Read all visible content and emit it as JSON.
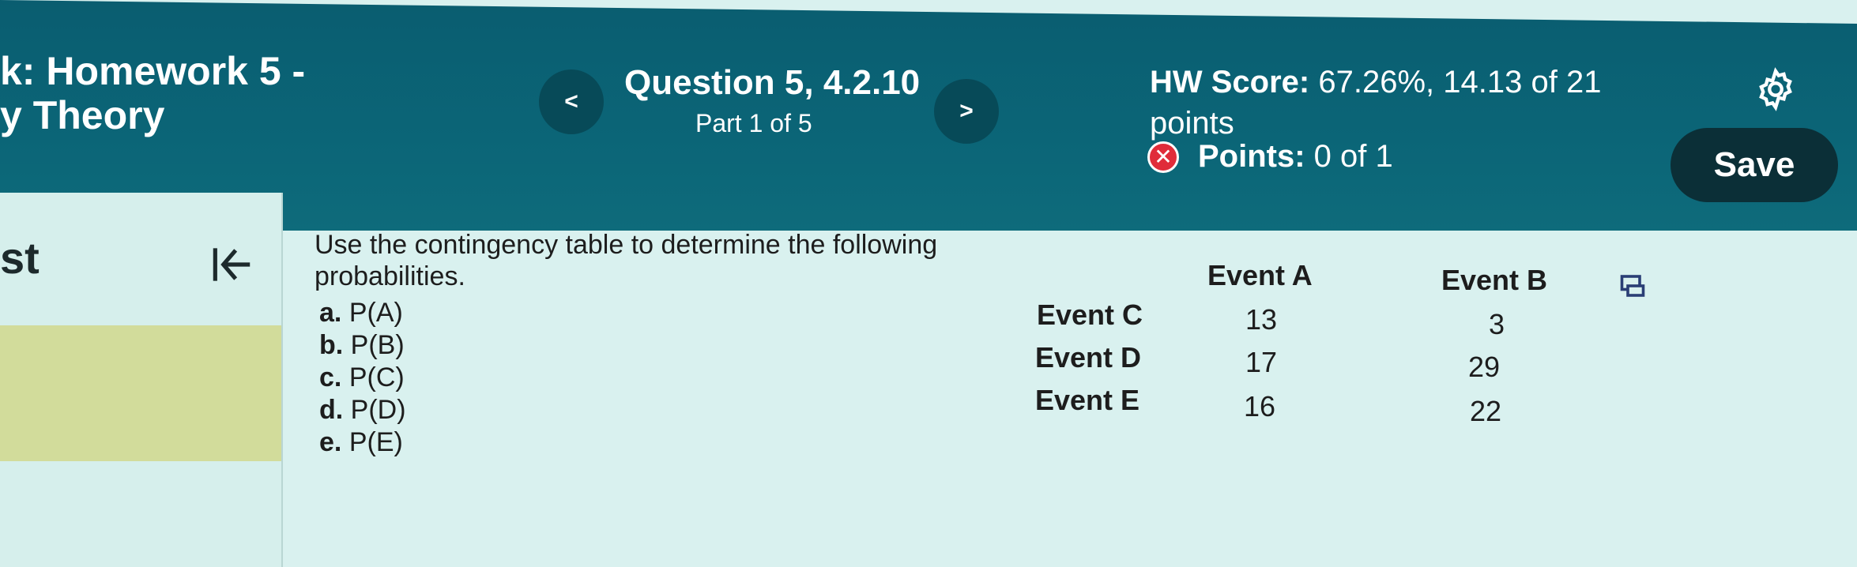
{
  "header": {
    "assignment_line1": "k: Homework 5 -",
    "assignment_line2": "y Theory",
    "question_title": "Question 5, 4.2.10",
    "question_part": "Part 1 of 5",
    "hw_score_label": "HW Score:",
    "hw_score_value": "67.26%, 14.13 of 21",
    "hw_score_tail": "points",
    "points_label": "Points:",
    "points_value": "0 of 1",
    "prev_label": "<",
    "next_label": ">",
    "save_label": "Save"
  },
  "sidebar": {
    "label": "st"
  },
  "question": {
    "prompt": "Use the contingency table to determine the following probabilities.",
    "parts": [
      {
        "letter": "a.",
        "text": "P(A)"
      },
      {
        "letter": "b.",
        "text": "P(B)"
      },
      {
        "letter": "c.",
        "text": "P(C)"
      },
      {
        "letter": "d.",
        "text": "P(D)"
      },
      {
        "letter": "e.",
        "text": "P(E)"
      }
    ]
  },
  "table": {
    "columns": [
      "Event A",
      "Event B"
    ],
    "rows": [
      {
        "label": "Event C",
        "values": [
          "13",
          "3"
        ]
      },
      {
        "label": "Event D",
        "values": [
          "17",
          "29"
        ]
      },
      {
        "label": "Event E",
        "values": [
          "16",
          "22"
        ]
      }
    ]
  },
  "colors": {
    "header_bg": "#0b6577",
    "save_bg": "#0b2f37",
    "incorrect": "#e02c3a",
    "highlight": "#d2dc9b"
  },
  "icons": [
    "previous-icon",
    "next-icon",
    "incorrect-icon",
    "gear-icon",
    "collapse-icon",
    "table-view-icon"
  ]
}
